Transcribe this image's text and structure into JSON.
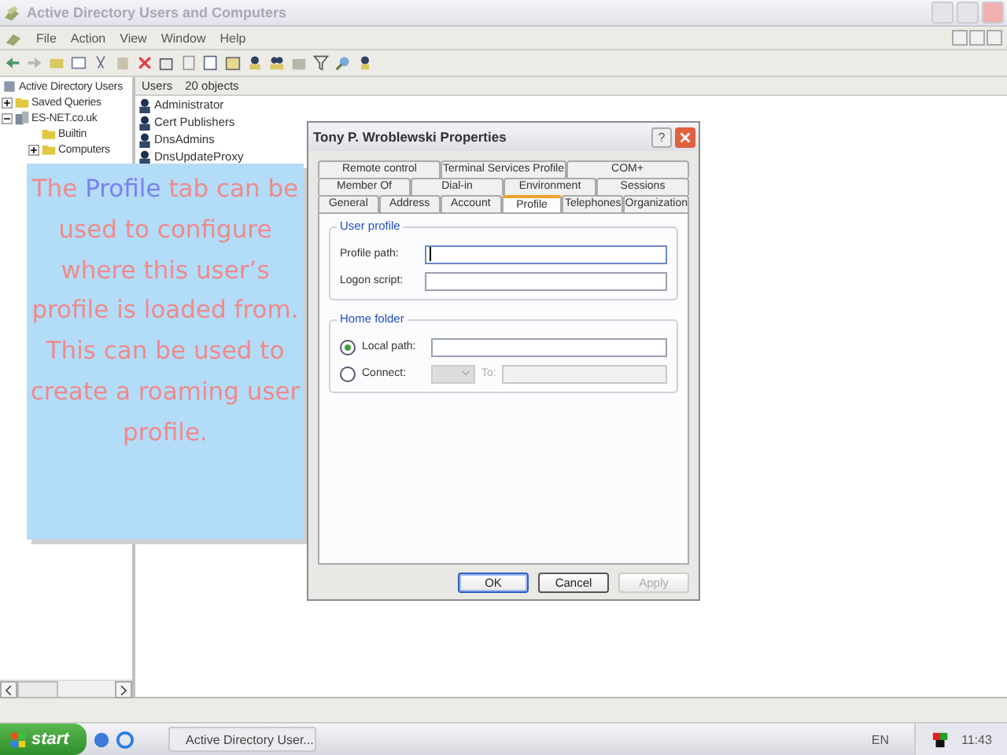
{
  "window": {
    "title": "Active Directory Users and Computers"
  },
  "menu": [
    "File",
    "Action",
    "View",
    "Window",
    "Help"
  ],
  "tree": [
    {
      "label": "Active Directory Users",
      "children": [
        {
          "label": "Saved Queries",
          "expanded": false
        },
        {
          "label": "ES-NET.co.uk",
          "expanded": true,
          "children": [
            {
              "label": "Builtin"
            },
            {
              "label": "Computers",
              "expanded": false
            }
          ]
        }
      ]
    }
  ],
  "list": {
    "title": "Users",
    "count": "20 objects",
    "items": [
      "Administrator",
      "Cert Publishers",
      "DnsAdmins",
      "DnsUpdateProxy"
    ]
  },
  "callout": {
    "before": "The ",
    "highlight": "Profile",
    "after": " tab can be used to configure where this user’s profile is loaded from. This can be used to create a roaming user profile."
  },
  "dialog": {
    "title": "Tony P. Wroblewski Properties",
    "help": "?",
    "tab_rows": [
      [
        {
          "label": "Remote control",
          "selected": false
        },
        {
          "label": "Terminal Services Profile",
          "selected": false
        },
        {
          "label": "COM+",
          "selected": false
        }
      ],
      [
        {
          "label": "Member Of",
          "selected": false
        },
        {
          "label": "Dial-in",
          "selected": false
        },
        {
          "label": "Environment",
          "selected": false
        },
        {
          "label": "Sessions",
          "selected": false
        }
      ],
      [
        {
          "label": "General",
          "selected": false
        },
        {
          "label": "Address",
          "selected": false
        },
        {
          "label": "Account",
          "selected": false
        },
        {
          "label": "Profile",
          "selected": true
        },
        {
          "label": "Telephones",
          "selected": false
        },
        {
          "label": "Organization",
          "selected": false
        }
      ]
    ],
    "user_profile": {
      "legend": "User profile",
      "fields": [
        {
          "label": "Profile path:",
          "focused": true
        },
        {
          "label": "Logon script:",
          "focused": false
        }
      ]
    },
    "home_folder": {
      "legend": "Home folder",
      "options": [
        {
          "label": "Local path:",
          "selected": true
        },
        {
          "label": "Connect:",
          "selected": false
        }
      ],
      "to_label": "To:",
      "connect_disabled": true
    },
    "buttons": [
      {
        "label": "OK",
        "disabled": false,
        "default": true
      },
      {
        "label": "Cancel",
        "disabled": false,
        "default": false
      },
      {
        "label": "Apply",
        "disabled": true,
        "default": false
      }
    ]
  },
  "taskbar": {
    "start": "start",
    "task": "Active Directory User...",
    "language": "EN",
    "clock": "11:43"
  }
}
